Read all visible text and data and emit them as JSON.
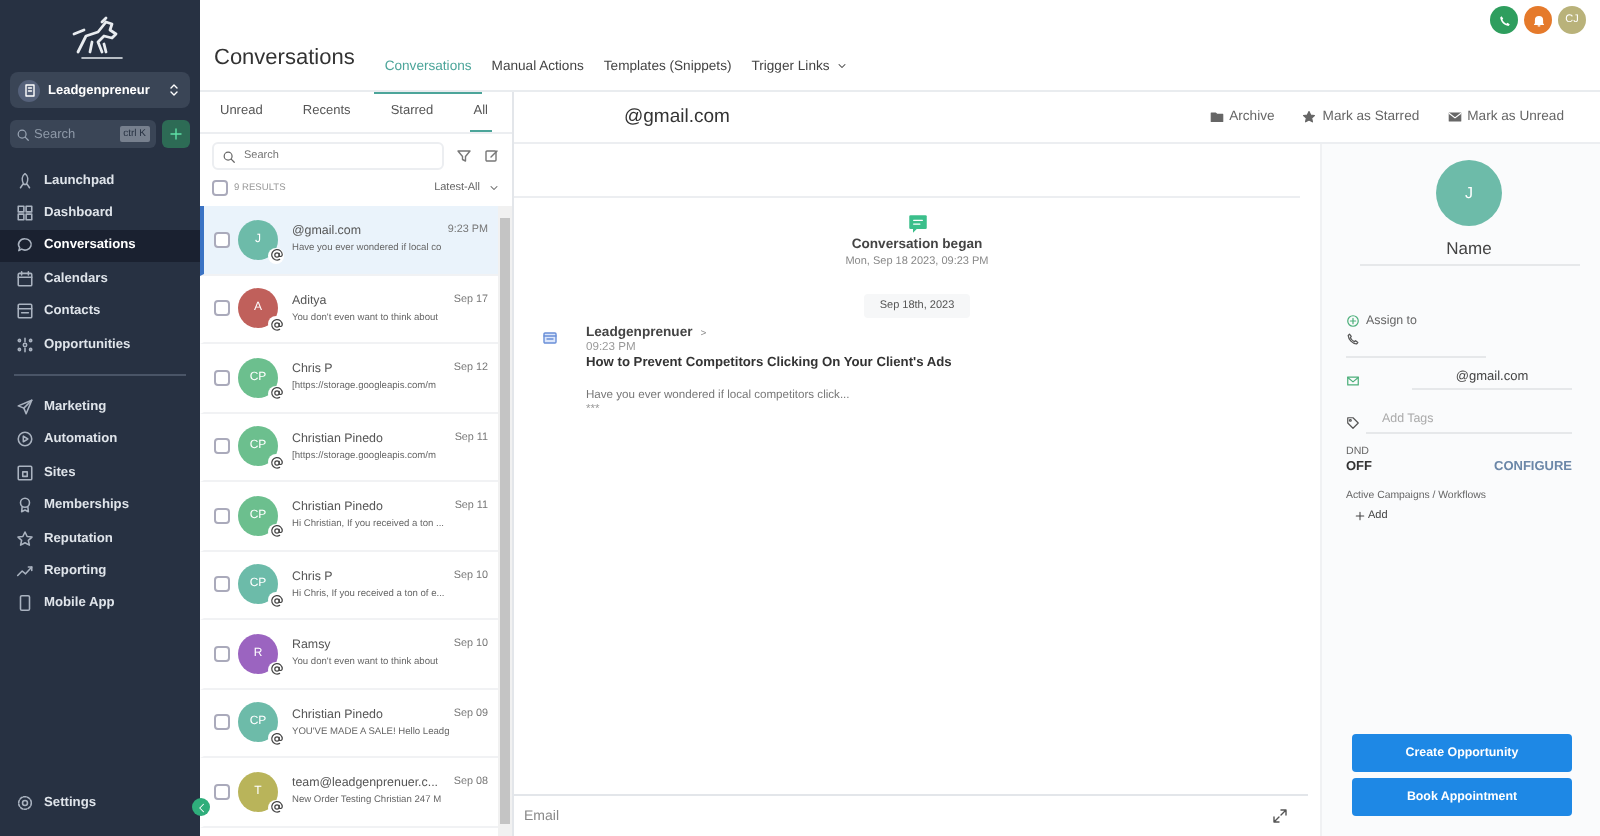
{
  "sidebar": {
    "account": "Leadgenpreneur",
    "search": {
      "placeholder": "Search",
      "shortcut": "ctrl K"
    },
    "sections": [
      {
        "items": [
          {
            "label": "Launchpad",
            "kind": "rocket",
            "selected": false
          },
          {
            "label": "Dashboard",
            "kind": "grid",
            "selected": false
          },
          {
            "label": "Conversations",
            "kind": "chat",
            "selected": true
          },
          {
            "label": "Calendars",
            "kind": "calendar",
            "selected": false
          },
          {
            "label": "Contacts",
            "kind": "contact",
            "selected": false
          },
          {
            "label": "Opportunities",
            "kind": "network",
            "selected": false
          }
        ]
      },
      {
        "items": [
          {
            "label": "Marketing",
            "kind": "send",
            "selected": false
          },
          {
            "label": "Automation",
            "kind": "play",
            "selected": false
          },
          {
            "label": "Sites",
            "kind": "site",
            "selected": false
          },
          {
            "label": "Memberships",
            "kind": "medal",
            "selected": false
          },
          {
            "label": "Reputation",
            "kind": "star",
            "selected": false
          },
          {
            "label": "Reporting",
            "kind": "trend",
            "selected": false
          },
          {
            "label": "Mobile App",
            "kind": "mobile",
            "selected": false
          }
        ]
      }
    ],
    "footer": {
      "label": "Settings",
      "kind": "gear",
      "selected": false
    }
  },
  "header": {
    "title": "Conversations",
    "tabs": [
      {
        "label": "Conversations",
        "selected": true,
        "menu": false
      },
      {
        "label": "Manual Actions",
        "selected": false,
        "menu": false
      },
      {
        "label": "Templates (Snippets)",
        "selected": false,
        "menu": false
      },
      {
        "label": "Trigger Links",
        "selected": false,
        "menu": true
      }
    ],
    "user_initials": "CJ"
  },
  "list": {
    "filters": [
      {
        "label": "Unread",
        "selected": false
      },
      {
        "label": "Recents",
        "selected": false
      },
      {
        "label": "Starred",
        "selected": false
      },
      {
        "label": "All",
        "selected": true
      }
    ],
    "search": {
      "placeholder": "Search"
    },
    "select_all": {
      "checked": false
    },
    "results": "9 RESULTS",
    "sort": "Latest-All",
    "rows": [
      {
        "initials": "J",
        "color": "#6dbba9",
        "name": "@gmail.com",
        "date": "9:23 PM",
        "preview": "Have you ever wondered if local co",
        "checked": false,
        "selected": true
      },
      {
        "initials": "A",
        "color": "#c0605b",
        "name": "Aditya",
        "date": "Sep 17",
        "preview": "You don't even want to think about",
        "checked": false,
        "selected": false
      },
      {
        "initials": "CP",
        "color": "#6cbf8e",
        "name": "Chris P",
        "date": "Sep 12",
        "preview": "[https://storage.googleapis.com/m",
        "checked": false,
        "selected": false
      },
      {
        "initials": "CP",
        "color": "#6cbf8e",
        "name": "Christian Pinedo",
        "date": "Sep 11",
        "preview": "[https://storage.googleapis.com/m",
        "checked": false,
        "selected": false
      },
      {
        "initials": "CP",
        "color": "#6cbf8e",
        "name": "Christian Pinedo",
        "date": "Sep 11",
        "preview": "Hi Christian, If you received a ton ...",
        "checked": false,
        "selected": false
      },
      {
        "initials": "CP",
        "color": "#6cbba9",
        "name": "Chris P",
        "date": "Sep 10",
        "preview": "Hi Chris, If you received a ton of e...",
        "checked": false,
        "selected": false
      },
      {
        "initials": "R",
        "color": "#9b64c0",
        "name": "Ramsy",
        "date": "Sep 10",
        "preview": "You don't even want to think about",
        "checked": false,
        "selected": false
      },
      {
        "initials": "CP",
        "color": "#6dbba9",
        "name": "Christian Pinedo",
        "date": "Sep 09",
        "preview": "YOU'VE MADE A SALE! Hello Leadg",
        "checked": false,
        "selected": false
      },
      {
        "initials": "T",
        "color": "#b9b45a",
        "name": "team@leadgenprenuer.c...",
        "date": "Sep 08",
        "preview": "New Order Testing Christian 247 M",
        "checked": false,
        "selected": false
      }
    ]
  },
  "chat": {
    "contact": "@gmail.com",
    "actions": [
      {
        "label": "Archive",
        "kind": "archive"
      },
      {
        "label": "Mark as Starred",
        "kind": "star"
      },
      {
        "label": "Mark as Unread",
        "kind": "unread"
      }
    ],
    "event": {
      "title": "Conversation began",
      "time": "Mon, Sep 18 2023, 09:23 PM"
    },
    "date_chip": "Sep 18th, 2023",
    "message": {
      "sender": "Leadgenprenuer",
      "caret": ">",
      "time": "09:23 PM",
      "subject": "How to Prevent Competitors Clicking On Your Client's Ads",
      "body": "Have you ever wondered if local competitors click...",
      "more": "***"
    },
    "composer": {
      "placeholder": "Email"
    }
  },
  "contact": {
    "initials": "J",
    "name": "Name",
    "assign": "Assign to",
    "email": "@gmail.com",
    "tags": {
      "placeholder": "Add Tags"
    },
    "dnd": {
      "label": "DND",
      "value": "OFF",
      "link": "CONFIGURE"
    },
    "campaigns": {
      "label": "Active Campaigns / Workflows",
      "add": "Add"
    },
    "buttons": [
      "Create Opportunity",
      "Book Appointment"
    ]
  }
}
